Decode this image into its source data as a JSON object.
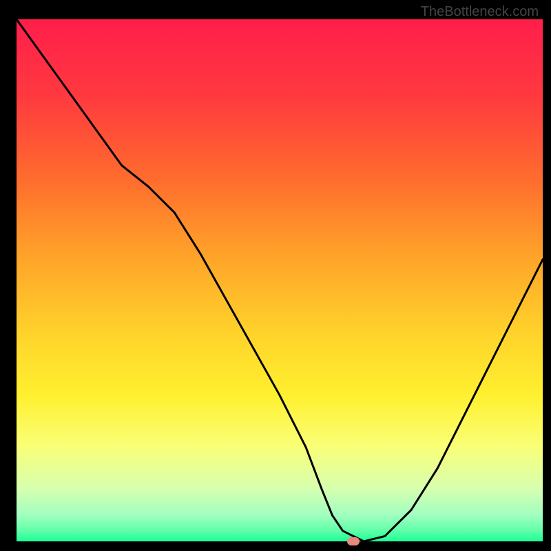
{
  "watermark": "TheBottleneck.com",
  "chart_data": {
    "type": "line",
    "title": "",
    "xlabel": "",
    "ylabel": "",
    "xlim": [
      0,
      100
    ],
    "ylim": [
      0,
      100
    ],
    "grid": false,
    "background_gradient_stops": [
      {
        "offset": 0.0,
        "color": "#ff1e4b"
      },
      {
        "offset": 0.15,
        "color": "#ff3a3f"
      },
      {
        "offset": 0.3,
        "color": "#ff6a2e"
      },
      {
        "offset": 0.45,
        "color": "#ffa229"
      },
      {
        "offset": 0.6,
        "color": "#ffd22b"
      },
      {
        "offset": 0.72,
        "color": "#fff02f"
      },
      {
        "offset": 0.82,
        "color": "#f9ff78"
      },
      {
        "offset": 0.9,
        "color": "#d6ffb0"
      },
      {
        "offset": 0.95,
        "color": "#a0ffc0"
      },
      {
        "offset": 0.98,
        "color": "#5effa8"
      },
      {
        "offset": 1.0,
        "color": "#1cff98"
      }
    ],
    "series": [
      {
        "name": "curve",
        "color": "#000000",
        "x": [
          0,
          5,
          10,
          15,
          20,
          25,
          30,
          35,
          40,
          45,
          50,
          55,
          58,
          60,
          62,
          64,
          66,
          70,
          75,
          80,
          85,
          90,
          95,
          100
        ],
        "y": [
          100,
          93,
          86,
          79,
          72,
          68,
          63,
          55,
          46,
          37,
          28,
          18,
          10,
          5,
          2,
          1,
          0,
          1,
          6,
          14,
          24,
          34,
          44,
          54
        ]
      }
    ],
    "marker": {
      "x": 64,
      "y": 0,
      "color": "#e88a7a"
    }
  }
}
